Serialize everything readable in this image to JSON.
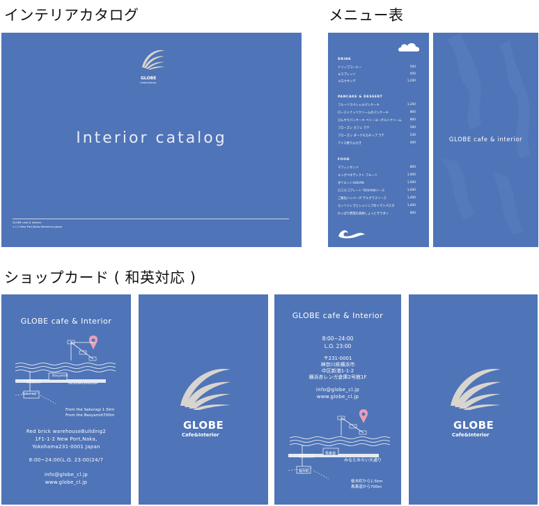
{
  "labels": {
    "catalog": "インテリアカタログ",
    "menu": "メニュー表",
    "cards": "ショップカード ( 和英対応 )"
  },
  "catalog": {
    "title": "Interior catalog",
    "logo_word": "GLOBE",
    "logo_sub": "Cafe&Interior",
    "footer1": "GLOBE cafe & interior",
    "footer2": "1-1-2 New Port,Naka,Yokohama,Japan"
  },
  "menu": {
    "drink_head": "DRINK",
    "drinks": [
      {
        "name": "ドリップコーヒー",
        "price": "500"
      },
      {
        "name": "エスプレッソ",
        "price": "450"
      },
      {
        "name": "メロウサンデ",
        "price": "1,200"
      }
    ],
    "pancake_head": "PANCAKE & DESSERT",
    "pancakes": [
      {
        "name": "フルーツスペシャルパンケーキ",
        "price": "1,200"
      },
      {
        "name": "ローストナッツクリームのパンケーキ",
        "price": "800"
      },
      {
        "name": "ひんやりパンケーキ ベリーヨーグルトクリーム",
        "price": "800"
      },
      {
        "name": "フローズン カフェ ラテ",
        "price": "500"
      },
      {
        "name": "フローズン ダークモカチップ ラテ",
        "price": "530"
      },
      {
        "name": "アイス煮りんかき",
        "price": "400"
      }
    ],
    "food_head": "FOOD",
    "foods": [
      {
        "name": "マフィンサンド",
        "price": "800"
      },
      {
        "name": "エッグベネディクト フルーツ",
        "price": "1,000"
      },
      {
        "name": "ダイエットGOHAN",
        "price": "1,000"
      },
      {
        "name": "ロコモコプレート TERIYAKIソース",
        "price": "1,000"
      },
      {
        "name": "ご飯化ハンバーグ デミグラスソース",
        "price": "1,400"
      },
      {
        "name": "モッツァレラとシュリンプのトマトパスタ",
        "price": "1,000"
      },
      {
        "name": "わっぱり野菜の具材しょっとサラダン",
        "price": "800"
      }
    ],
    "back_title": "GLOBE cafe & interior"
  },
  "card_en": {
    "title": "GLOBE cafe & Interior",
    "station1": "Sakuragi",
    "station2": "Basyamiti",
    "avenue": "MinatoMiraiAvenue",
    "dist1": "From the Sakuragi 1.5km",
    "dist2": "From the Basyamiti700m",
    "addr1": "Red brick warehouseBuilding2",
    "addr2": "1F1-1-2 New Port,Naka,",
    "addr3": "Yokohama231-0001 Japan",
    "hours": "8:00~24:00(L.O. 23:00)24/7",
    "email": "info@globe_cl.jp",
    "web": "www.globe_cl.jp"
  },
  "card_jp": {
    "title": "GLOBE cafe & Interior",
    "hours": "8:00~24:00",
    "lo": "L.O.  23:00",
    "zip": "〒231-0001",
    "addr1": "神奈川県横浜市",
    "addr2": "中区新港1-1-2",
    "addr3": "横浜赤レンガ倉庫2号館1F",
    "email": "info@globe_cl.jp",
    "web": "www.globe_cl.jp",
    "station1": "桜木町",
    "station2": "馬車道",
    "avenue": "みなとみらい大通り",
    "dist1": "桜木町から1.5km",
    "dist2": "馬車道から700m"
  },
  "card_logo": {
    "word": "GLOBE",
    "sub": "Cafe&Interior"
  },
  "colors": {
    "panel": "#4f74b7",
    "logo_arc": "#d8d4cf",
    "pin": "#e89fb6"
  }
}
